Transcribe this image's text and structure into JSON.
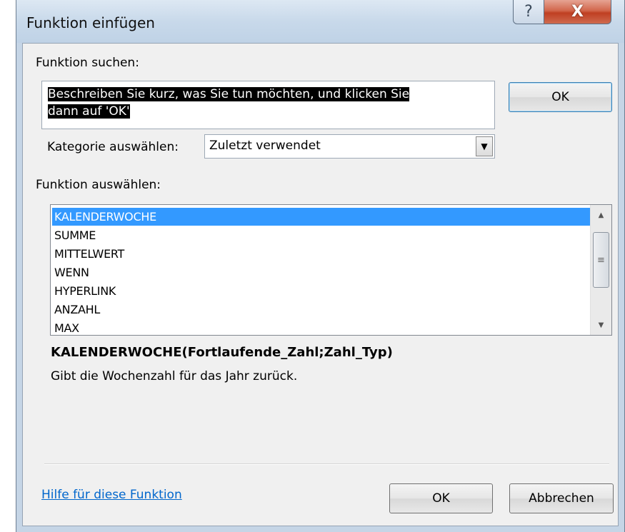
{
  "window": {
    "title": "Funktion einfügen",
    "help_glyph": "?",
    "close_glyph": "X"
  },
  "search": {
    "label": "Funktion suchen:",
    "value_line1": "Beschreiben Sie kurz, was Sie tun möchten, und klicken Sie",
    "value_line2": "dann auf 'OK'",
    "ok_label": "OK"
  },
  "category": {
    "label": "Kategorie auswählen:",
    "selected": "Zuletzt verwendet",
    "arrow_icon": "chevron-down-icon"
  },
  "functions": {
    "label": "Funktion auswählen:",
    "items": [
      "KALENDERWOCHE",
      "SUMME",
      "MITTELWERT",
      "WENN",
      "HYPERLINK",
      "ANZAHL",
      "MAX"
    ],
    "selected_index": 0
  },
  "details": {
    "signature": "KALENDERWOCHE(Fortlaufende_Zahl;Zahl_Typ)",
    "description": "Gibt die Wochenzahl für das Jahr zurück."
  },
  "footer": {
    "help_link": "Hilfe für diese Funktion",
    "ok_label": "OK",
    "cancel_label": "Abbrechen"
  },
  "colors": {
    "selection": "#3399ff",
    "link": "#0066cc",
    "frame": "#c5d5e6"
  }
}
